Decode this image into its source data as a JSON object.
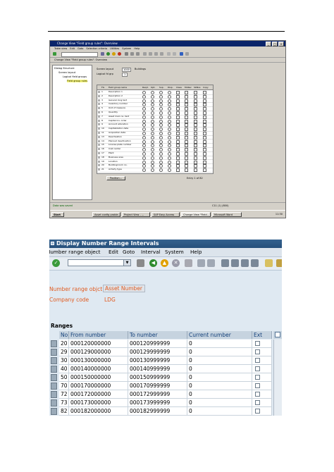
{
  "shot1": {
    "title": "Change View \"Field group rules\": Overview",
    "menu": [
      "Table view",
      "Edit",
      "Goto",
      "Selection criteria",
      "Utilities",
      "System",
      "Help"
    ],
    "subtitle": "Change View \"Field group rules\": Overview",
    "tree": [
      "Dialog Structure",
      "Screen layout",
      "Logical field groups",
      "Field group rules"
    ],
    "screen_layout_label": "Screen layout",
    "screen_layout_value": "1000",
    "screen_layout_desc": "Buildings",
    "logical_fld_grp_label": "Logical fd grp",
    "logical_fld_grp_value": "1",
    "grid_headers": [
      "FG",
      "Field group name",
      "Reqd.",
      "Opt.",
      "Sup.",
      "Disp.",
      "Class",
      "MnRec",
      "SbNos",
      "Copy"
    ],
    "grid_rows": [
      [
        "1",
        "Description 1"
      ],
      [
        "2",
        "Description 2"
      ],
      [
        "3",
        "General long text"
      ],
      [
        "4",
        "Inventory number"
      ],
      [
        "5",
        "Unit of measure"
      ],
      [
        "6",
        "Quantity"
      ],
      [
        "7",
        "Asset main no. text"
      ],
      [
        "8",
        "Capital inv. order"
      ],
      [
        "9",
        "Account allocation"
      ],
      [
        "10",
        "Capitalization date"
      ],
      [
        "11",
        "Acquisition data"
      ],
      [
        "13",
        "Deactivation"
      ],
      [
        "14",
        "Planned deactivation"
      ],
      [
        "15",
        "License plate number"
      ],
      [
        "16",
        "Cost center"
      ],
      [
        "17",
        "Plant"
      ],
      [
        "18",
        "Business area"
      ],
      [
        "19",
        "Location"
      ],
      [
        "20",
        "Building/room no."
      ],
      [
        "21",
        "Activity type"
      ]
    ],
    "position_button": "Position...",
    "entry_text": "Entry 1 of 82",
    "status_message": "Data was saved",
    "status_right": "C11 (1) (800) ",
    "taskbar": [
      "Start",
      "Asset config proble...",
      "Project View - ...",
      "SAP Easy Access",
      "Change View \"Field...",
      "Microsoft Word"
    ],
    "clock": "11:30"
  },
  "shot2": {
    "title": "Display Number Range Intervals",
    "menu": [
      "Number range object",
      "Edit",
      "Goto",
      "Interval",
      "System",
      "Help"
    ],
    "command_placeholder": "",
    "fields": {
      "object_label": "Number range objct",
      "object_value": "Asset Number",
      "company_label": "Company code",
      "company_value": "LDG"
    },
    "ranges_heading": "Ranges",
    "columns": [
      "No",
      "From number",
      "To number",
      "Current number",
      "Ext"
    ],
    "rows": [
      {
        "no": "20",
        "from": "000120000000",
        "to": "000120999999",
        "current": "0"
      },
      {
        "no": "29",
        "from": "000129000000",
        "to": "000129999999",
        "current": "0"
      },
      {
        "no": "30",
        "from": "000130000000",
        "to": "000130999999",
        "current": "0"
      },
      {
        "no": "40",
        "from": "000140000000",
        "to": "000140999999",
        "current": "0"
      },
      {
        "no": "50",
        "from": "000150000000",
        "to": "000150999999",
        "current": "0"
      },
      {
        "no": "70",
        "from": "000170000000",
        "to": "000170999999",
        "current": "0"
      },
      {
        "no": "72",
        "from": "000172000000",
        "to": "000172999999",
        "current": "0"
      },
      {
        "no": "73",
        "from": "000173000000",
        "to": "000173999999",
        "current": "0"
      },
      {
        "no": "82",
        "from": "000182000000",
        "to": "000182999999",
        "current": "0"
      }
    ]
  }
}
